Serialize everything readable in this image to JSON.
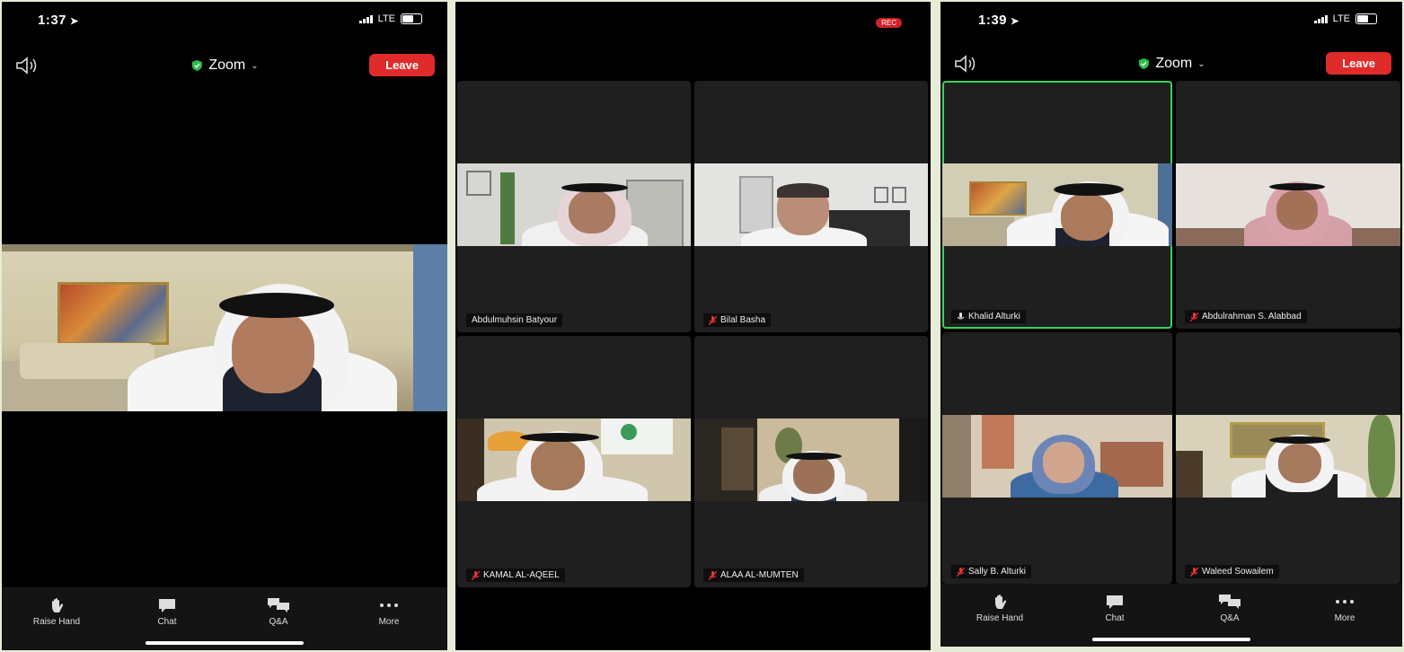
{
  "phone1": {
    "time": "1:37",
    "network": "LTE",
    "title": "Zoom",
    "leave_label": "Leave",
    "controls": [
      {
        "label": "Raise Hand",
        "icon": "hand-icon"
      },
      {
        "label": "Chat",
        "icon": "chat-icon"
      },
      {
        "label": "Q&A",
        "icon": "qa-icon"
      },
      {
        "label": "More",
        "icon": "more-icon"
      }
    ]
  },
  "phone2": {
    "rec_label": "REC",
    "participants": [
      {
        "name": "Abdulmuhsin Batyour",
        "muted": false
      },
      {
        "name": "Bilal Basha",
        "muted": true
      },
      {
        "name": "KAMAL AL-AQEEL",
        "muted": true
      },
      {
        "name": "ALAA AL-MUMTEN",
        "muted": true
      }
    ]
  },
  "phone3": {
    "time": "1:39",
    "network": "LTE",
    "title": "Zoom",
    "leave_label": "Leave",
    "participants": [
      {
        "name": "Khalid Alturki",
        "muted": false,
        "active": true
      },
      {
        "name": "Abdulrahman S. Alabbad",
        "muted": true
      },
      {
        "name": "Sally B. Alturki",
        "muted": true
      },
      {
        "name": "Waleed Sowailem",
        "muted": true
      }
    ],
    "controls": [
      {
        "label": "Raise Hand",
        "icon": "hand-icon"
      },
      {
        "label": "Chat",
        "icon": "chat-icon"
      },
      {
        "label": "Q&A",
        "icon": "qa-icon"
      },
      {
        "label": "More",
        "icon": "more-icon"
      }
    ]
  },
  "colors": {
    "leave": "#e02b2b",
    "active_border": "#3ad15a",
    "shield": "#2fbf4a",
    "rec": "#d0222a"
  }
}
